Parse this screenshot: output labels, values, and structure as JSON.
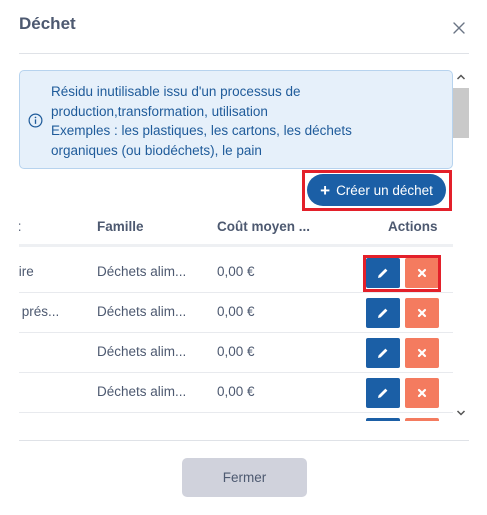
{
  "dialog": {
    "title": "Déchet",
    "close_icon": "close-icon"
  },
  "info": {
    "icon": "info-circle-icon",
    "lines": [
      "Résidu inutilisable issu d'un processus de",
      "production,transformation, utilisation",
      "Exemples : les plastiques, les cartons, les déchets",
      "organiques (ou biodéchets), le pain"
    ]
  },
  "create_button": {
    "icon": "plus-icon",
    "label": "Créer un déchet"
  },
  "table": {
    "headers": {
      "name": "t",
      "family": "Famille",
      "cost": "Coût moyen ...",
      "actions": "Actions"
    },
    "rows": [
      {
        "name": "ntaire",
        "family": "Déchets alim...",
        "cost": "0,00 €"
      },
      {
        "name": "nts prés...",
        "family": "Déchets alim...",
        "cost": "0,00 €"
      },
      {
        "name": "",
        "family": "Déchets alim...",
        "cost": "0,00 €"
      },
      {
        "name": "",
        "family": "Déchets alim...",
        "cost": "0,00 €"
      }
    ],
    "edit_icon": "pencil-icon",
    "delete_icon": "x-icon"
  },
  "footer": {
    "close_label": "Fermer"
  },
  "colors": {
    "primary": "#1b5fa6",
    "danger": "#f47b5f",
    "info_bg": "#e6f0fa",
    "info_text": "#1f5b9a",
    "highlight": "#e3202a",
    "secondary_button": "#d0d2dc"
  }
}
